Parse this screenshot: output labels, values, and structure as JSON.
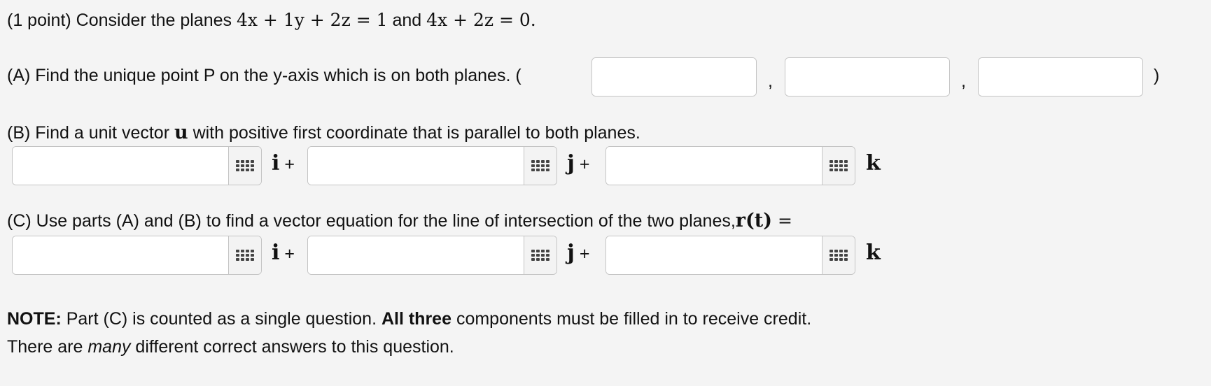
{
  "intro": {
    "prefix": "(1 point) Consider the planes ",
    "plane1": "4x + 1y + 2z = 1",
    "mid": " and ",
    "plane2": "4x + 2z = 0",
    "suffix": "."
  },
  "partA": {
    "text": "(A) Find the unique point P on the y-axis which is on both planes. (",
    "comma1": ",",
    "comma2": ",",
    "close": ")"
  },
  "partB": {
    "text_before": "(B) Find a unit vector ",
    "vec": "u",
    "text_after": " with positive first coordinate that is parallel to both planes."
  },
  "partC": {
    "text": "(C) Use parts (A) and (B) to find a vector equation for the line of intersection of the two planes,",
    "rt": "r(t)",
    "eq": " ="
  },
  "units": {
    "i": "i",
    "j": "j",
    "k": "k",
    "plus": "+"
  },
  "note": {
    "label": "NOTE:",
    "text1": " Part (C) is counted as a single question. ",
    "bold": "All three",
    "text2": " components must be filled in to receive credit.",
    "line2_before": "There are ",
    "many": "many",
    "line2_after": " different correct answers to this question."
  },
  "icons": {
    "keypad": "keypad-grid-icon"
  }
}
